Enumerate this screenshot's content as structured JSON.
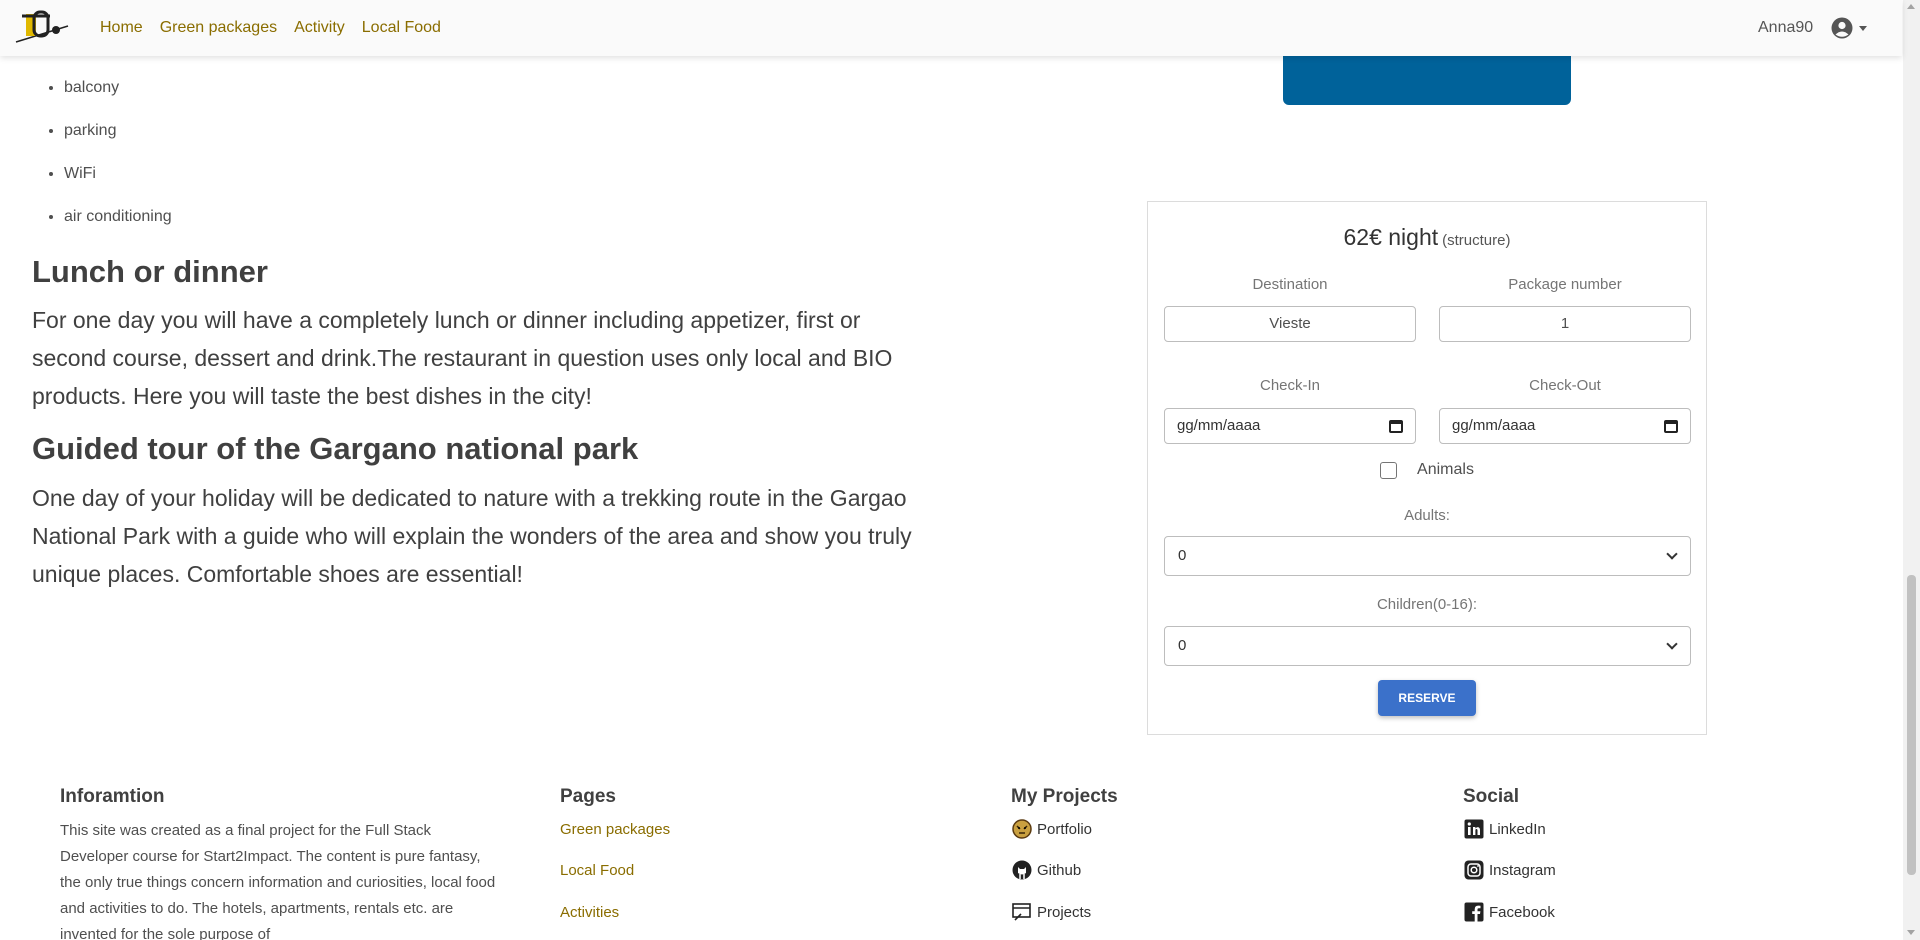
{
  "nav": {
    "links": [
      "Home",
      "Green packages",
      "Activity",
      "Local Food"
    ],
    "username": "Anna90",
    "avatar_icon": "user-circle-icon"
  },
  "content": {
    "amenities": [
      "balcony",
      "parking",
      "WiFi",
      "air conditioning"
    ],
    "lunch_title": "Lunch or dinner",
    "lunch_text": "For one day you will have a completely lunch or dinner including appetizer, first or second course, dessert and drink.The restaurant in question uses only local and BIO products. Here you will taste the best dishes in the city!",
    "tour_title": "Guided tour of the Gargano national park",
    "tour_text": "One day of your holiday will be dedicated to nature with a trekking route in the Gargao National Park with a guide who will explain the wonders of the area and show you truly unique places. Comfortable shoes are essential!"
  },
  "booking": {
    "price": "62€ night",
    "price_note": "(structure)",
    "destination_label": "Destination",
    "destination_value": "Vieste",
    "package_label": "Package number",
    "package_value": "1",
    "checkin_label": "Check-In",
    "checkin_placeholder": "gg/mm/aaaa",
    "checkout_label": "Check-Out",
    "checkout_placeholder": "gg/mm/aaaa",
    "animals_label": "Animals",
    "adults_label": "Adults:",
    "adults_value": "0",
    "children_label": "Children(0-16):",
    "children_value": "0",
    "reserve_label": "RESERVE",
    "accent_color": "#3b71ca"
  },
  "footer": {
    "info_title": "Inforamtion",
    "info_text": "This site was created as a final project for the Full Stack Developer course for Start2Impact. The content is pure fantasy, the only true things concern information and curiosities, local food and activities to do. The hotels, apartments, rentals etc. are invented for the sole purpose of",
    "pages_title": "Pages",
    "pages_links": [
      "Green packages",
      "Local Food",
      "Activities"
    ],
    "projects_title": "My Projects",
    "projects": [
      {
        "label": "Portfolio",
        "icon": "tiger-icon"
      },
      {
        "label": "Github",
        "icon": "github-icon"
      },
      {
        "label": "Projects",
        "icon": "projects-icon"
      }
    ],
    "social_title": "Social",
    "social": [
      {
        "label": "LinkedIn",
        "icon": "linkedin-icon"
      },
      {
        "label": "Instagram",
        "icon": "instagram-icon"
      },
      {
        "label": "Facebook",
        "icon": "facebook-icon"
      }
    ]
  }
}
